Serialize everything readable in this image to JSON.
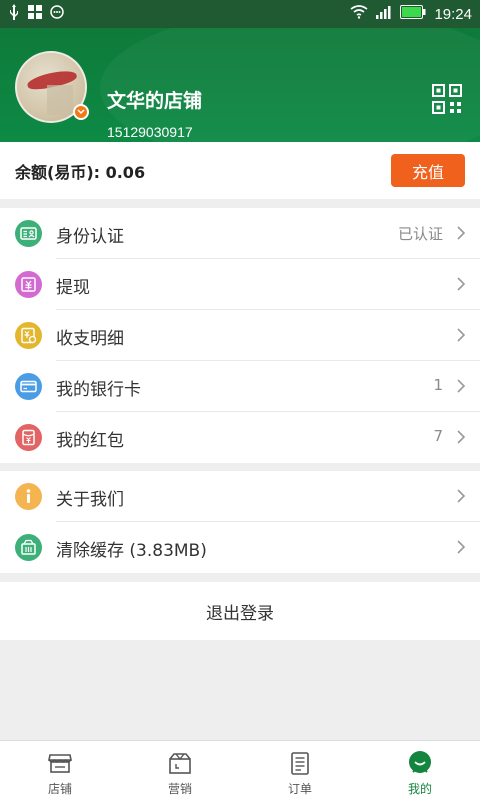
{
  "status_bar": {
    "time": "19:24"
  },
  "profile": {
    "shop_name": "文华的店铺",
    "phone": "15129030917"
  },
  "balance": {
    "label": "余额(易币): 0.06",
    "recharge_button": "充值"
  },
  "menu_group1": [
    {
      "label": "身份认证",
      "value": "已认证",
      "icon": "id-card-icon",
      "color": "#3db07a"
    },
    {
      "label": "提现",
      "value": "",
      "icon": "withdraw-icon",
      "color": "#d36ad2"
    },
    {
      "label": "收支明细",
      "value": "",
      "icon": "ledger-icon",
      "color": "#e3b72d"
    },
    {
      "label": "我的银行卡",
      "value": "1",
      "icon": "bank-card-icon",
      "color": "#4a9de5"
    },
    {
      "label": "我的红包",
      "value": "7",
      "icon": "red-packet-icon",
      "color": "#e36464"
    }
  ],
  "menu_group2": [
    {
      "label": "关于我们",
      "value": "",
      "icon": "info-icon",
      "color": "#f4b450"
    },
    {
      "label": "清除缓存 (3.83MB)",
      "value": "",
      "icon": "trash-bin-icon",
      "color": "#3db07a"
    }
  ],
  "logout_label": "退出登录",
  "tabs": [
    {
      "label": "店铺",
      "icon": "store-icon",
      "active": false
    },
    {
      "label": "营销",
      "icon": "marketing-icon",
      "active": false
    },
    {
      "label": "订单",
      "icon": "order-icon",
      "active": false
    },
    {
      "label": "我的",
      "icon": "profile-icon",
      "active": true
    }
  ],
  "colors": {
    "header_green": "#0f7a3a",
    "accent_orange": "#f0611e",
    "active_tab": "#13853f"
  }
}
